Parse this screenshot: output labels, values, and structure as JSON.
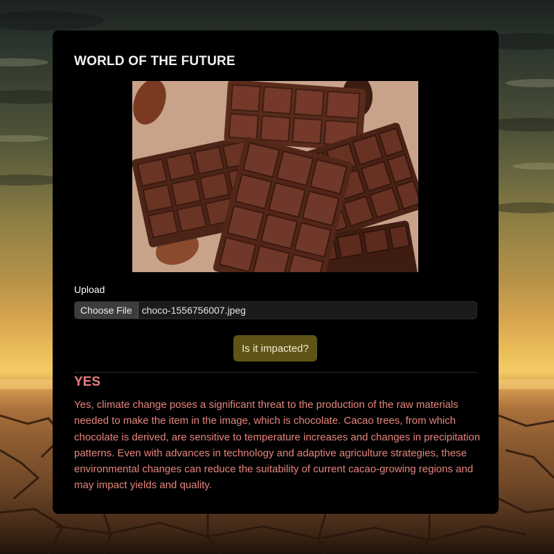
{
  "app": {
    "title": "WORLD OF THE FUTURE"
  },
  "preview": {
    "image_icon": "chocolate-bars-photo"
  },
  "upload": {
    "label": "Upload",
    "choose_button": "Choose File",
    "file_name": "choco-1556756007.jpeg"
  },
  "actions": {
    "submit_label": "Is it impacted?"
  },
  "result": {
    "answer": "YES",
    "explanation": "Yes, climate change poses a significant threat to the production of the raw materials needed to make the item in the image, which is chocolate. Cacao trees, from which chocolate is derived, are sensitive to temperature increases and changes in precipitation patterns. Even with advances in technology and adaptive agriculture strategies, these environmental changes can reduce the suitability of current cacao-growing regions and may impact yields and quality."
  },
  "colors": {
    "card_bg": "#000000",
    "answer_color": "#e97d7d",
    "button_bg": "#5f5417"
  }
}
